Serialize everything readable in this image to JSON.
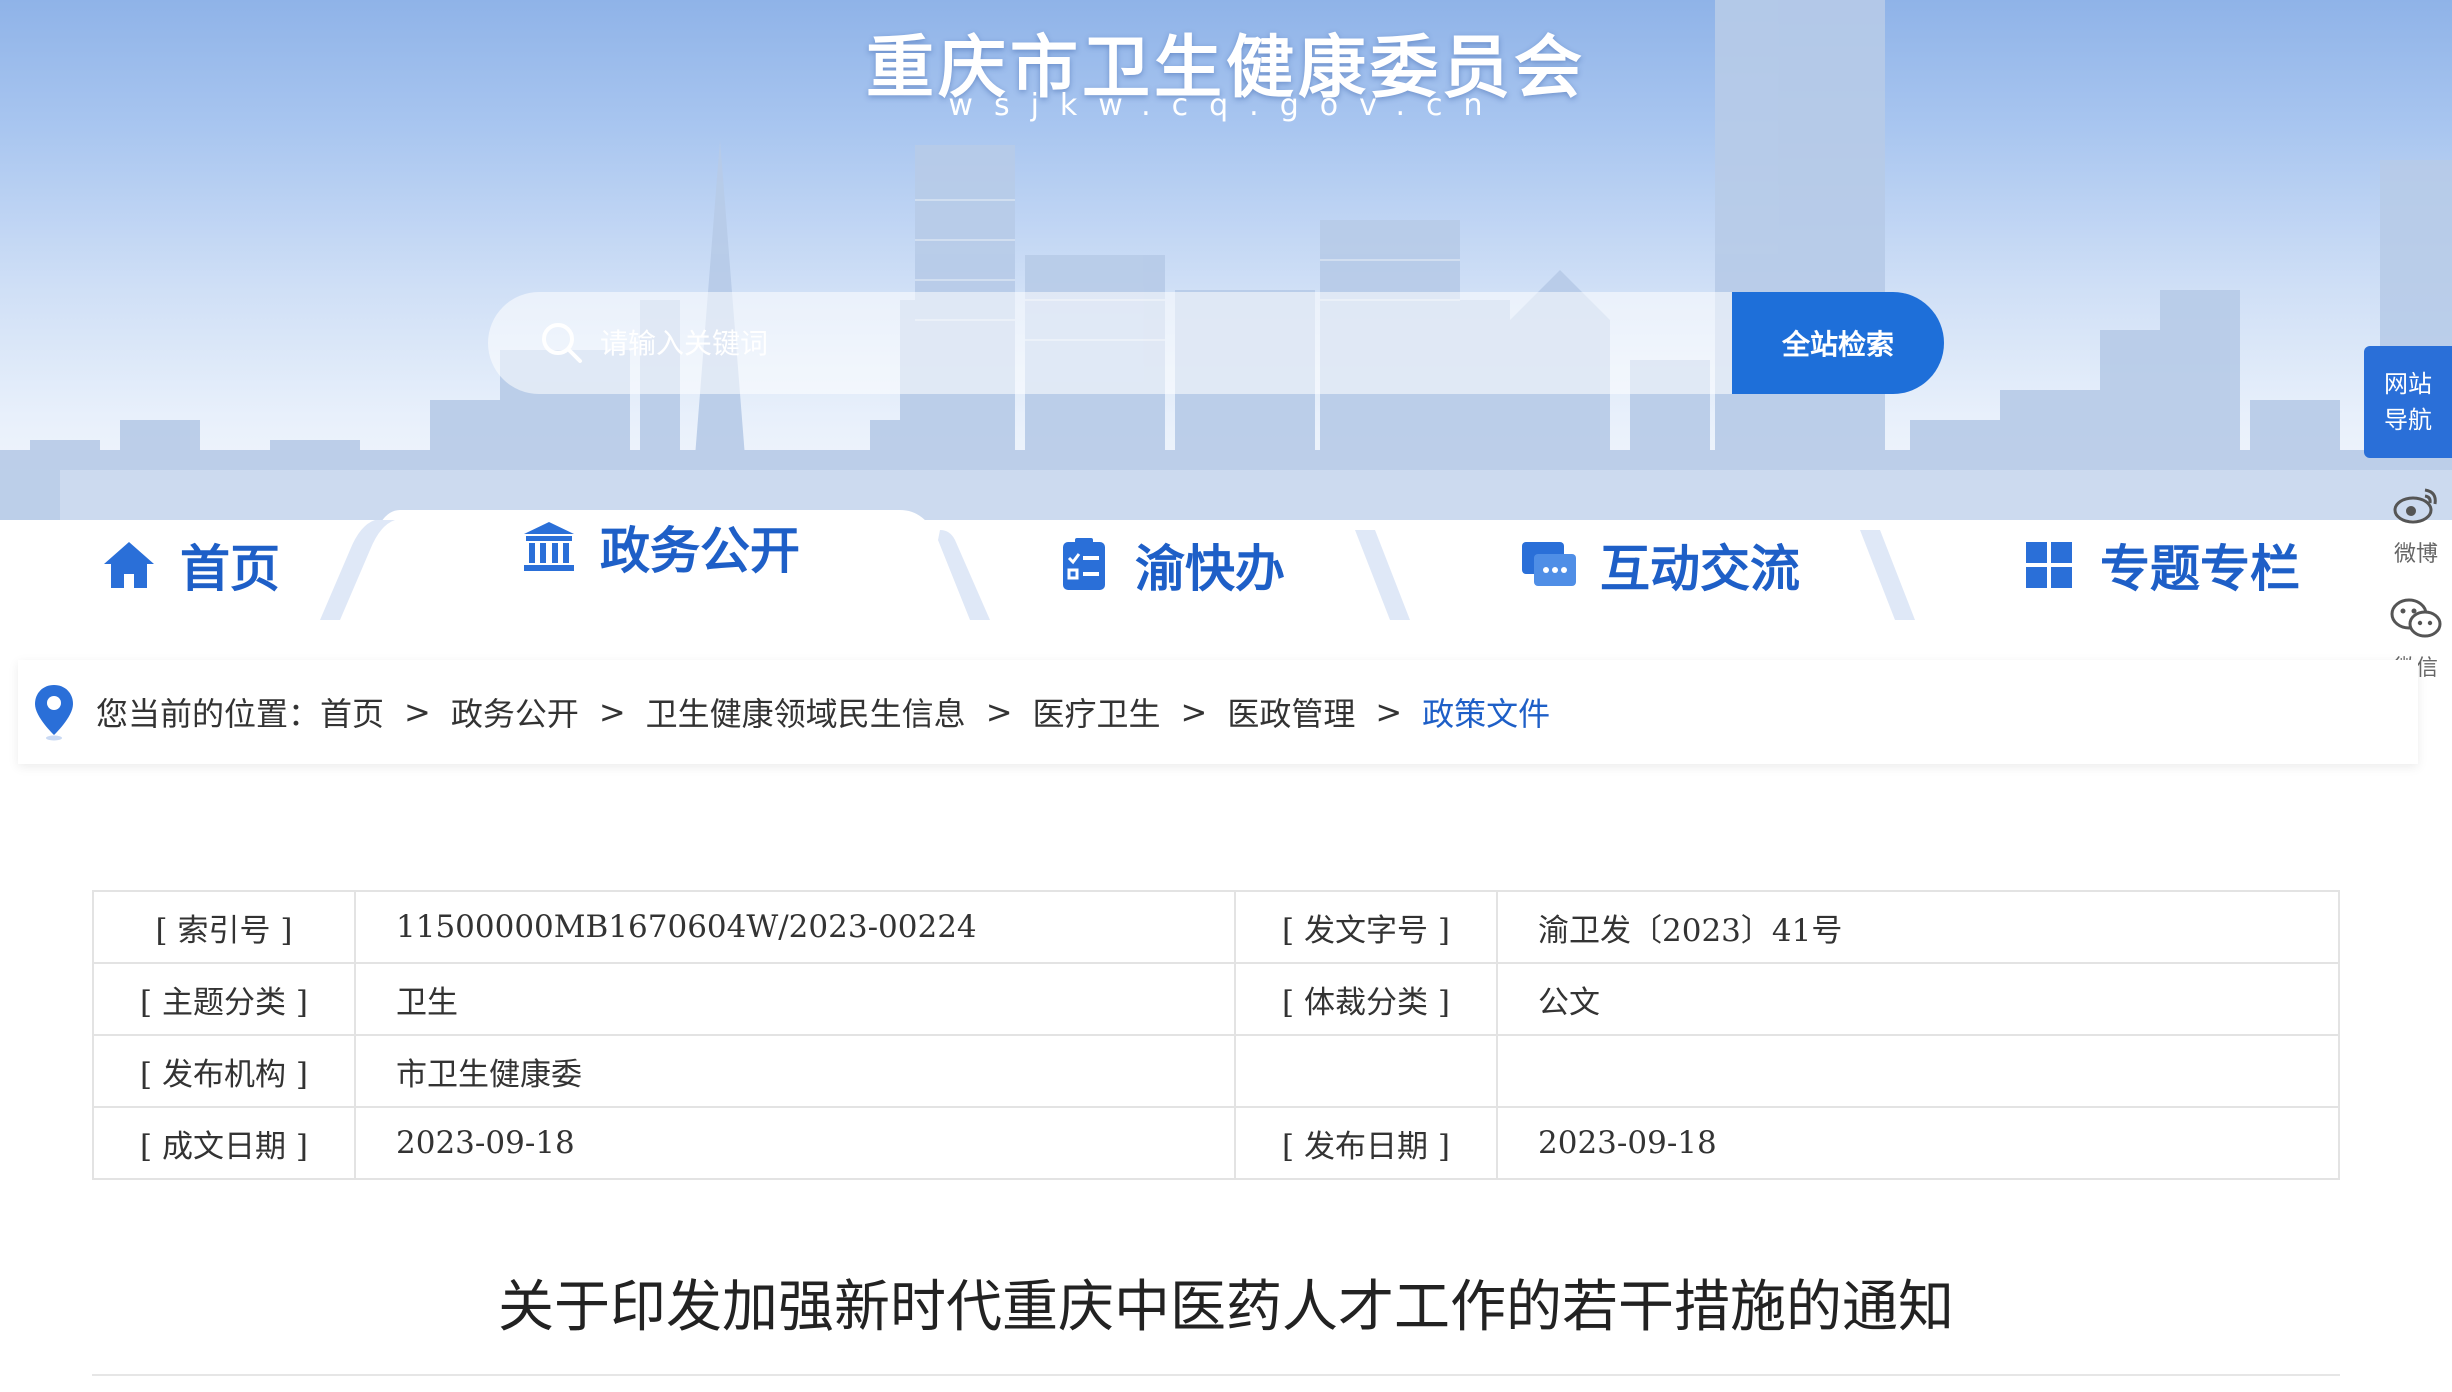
{
  "site": {
    "title": "重庆市卫生健康委员会",
    "domain": "wsjkw.cq.gov.cn"
  },
  "search": {
    "placeholder": "请输入关键词",
    "button_label": "全站检索"
  },
  "nav": {
    "items": [
      {
        "label": "首页",
        "icon": "home-icon"
      },
      {
        "label": "政务公开",
        "icon": "government-building-icon",
        "active": true
      },
      {
        "label": "渝快办",
        "icon": "checklist-icon"
      },
      {
        "label": "互动交流",
        "icon": "chat-bubbles-icon"
      },
      {
        "label": "专题专栏",
        "icon": "grid-icon"
      }
    ]
  },
  "side": {
    "site_nav": "网站导航",
    "weibo": "微博",
    "wechat": "微信"
  },
  "breadcrumb": {
    "prefix": "您当前的位置：",
    "items": [
      "首页",
      "政务公开",
      "卫生健康领域民生信息",
      "医疗卫生",
      "医政管理",
      "政策文件"
    ],
    "separator": ">"
  },
  "info": {
    "rows": [
      {
        "k1": "[ 索引号 ]",
        "v1": "11500000MB1670604W/2023-00224",
        "k2": "[ 发文字号 ]",
        "v2": "渝卫发〔2023〕41号"
      },
      {
        "k1": "[ 主题分类 ]",
        "v1": "卫生",
        "k2": "[ 体裁分类 ]",
        "v2": "公文"
      },
      {
        "k1": "[ 发布机构 ]",
        "v1": "市卫生健康委",
        "k2": "",
        "v2": ""
      },
      {
        "k1": "[ 成文日期 ]",
        "v1": "2023-09-18",
        "k2": "[ 发布日期 ]",
        "v2": "2023-09-18"
      }
    ]
  },
  "document": {
    "title": "关于印发加强新时代重庆中医药人才工作的若干措施的通知"
  },
  "colors": {
    "accent": "#1e6fd9",
    "nav_text": "#1e5fc7"
  }
}
